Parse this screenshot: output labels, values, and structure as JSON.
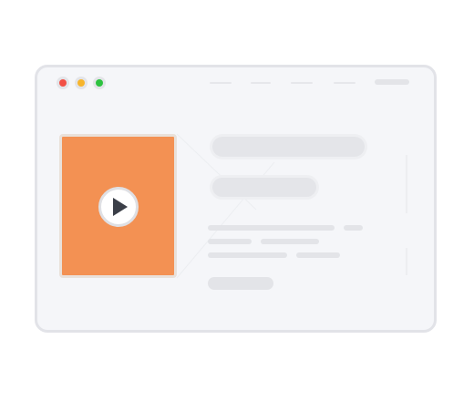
{
  "illustration": {
    "kind": "browser-window-video-page-wireframe",
    "window_controls": [
      "close",
      "minimize",
      "maximize"
    ],
    "nav_placeholders": 4,
    "media": {
      "icon": "play-icon"
    },
    "text_placeholders": {
      "title_lines": 1,
      "subtitle_lines": 1,
      "body_lines": 3
    }
  },
  "colors": {
    "window_bg": "#f5f6f9",
    "window_border": "#e2e3e8",
    "placeholder": "#e3e4e8",
    "media_fill": "#f39153",
    "play_glyph": "#3b3f48",
    "dot_red": "#f24f45",
    "dot_yellow": "#f7b52c",
    "dot_green": "#2dc240"
  }
}
